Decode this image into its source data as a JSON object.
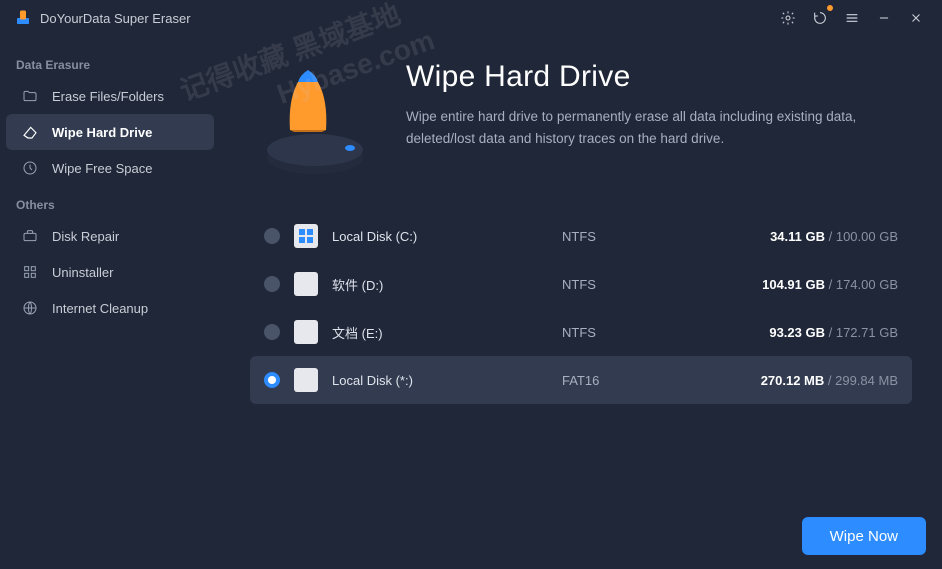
{
  "app": {
    "title": "DoYourData Super Eraser"
  },
  "sidebar": {
    "group1": {
      "header": "Data Erasure"
    },
    "items1": [
      {
        "label": "Erase Files/Folders"
      },
      {
        "label": "Wipe Hard Drive"
      },
      {
        "label": "Wipe Free Space"
      }
    ],
    "group2": {
      "header": "Others"
    },
    "items2": [
      {
        "label": "Disk Repair"
      },
      {
        "label": "Uninstaller"
      },
      {
        "label": "Internet Cleanup"
      }
    ]
  },
  "page": {
    "title": "Wipe Hard Drive",
    "description": "Wipe entire hard drive to permanently erase all data including existing data, deleted/lost data and history traces on the hard drive."
  },
  "drives": [
    {
      "name": "Local Disk (C:)",
      "fs": "NTFS",
      "used": "34.11 GB",
      "total": "100.00 GB",
      "sys": true,
      "selected": false
    },
    {
      "name": "软件 (D:)",
      "fs": "NTFS",
      "used": "104.91 GB",
      "total": "174.00 GB",
      "sys": false,
      "selected": false
    },
    {
      "name": "文档 (E:)",
      "fs": "NTFS",
      "used": "93.23 GB",
      "total": "172.71 GB",
      "sys": false,
      "selected": false
    },
    {
      "name": "Local Disk (*:)",
      "fs": "FAT16",
      "used": "270.12 MB",
      "total": "299.84 MB",
      "sys": false,
      "selected": true
    }
  ],
  "actions": {
    "wipe_now": "Wipe Now"
  },
  "watermark": {
    "line1": "记得收藏 黑域基地",
    "line2": "Hybase.com"
  },
  "colors": {
    "accent": "#2d8cff",
    "bg": "#1f2738",
    "sel": "#323b4f"
  }
}
